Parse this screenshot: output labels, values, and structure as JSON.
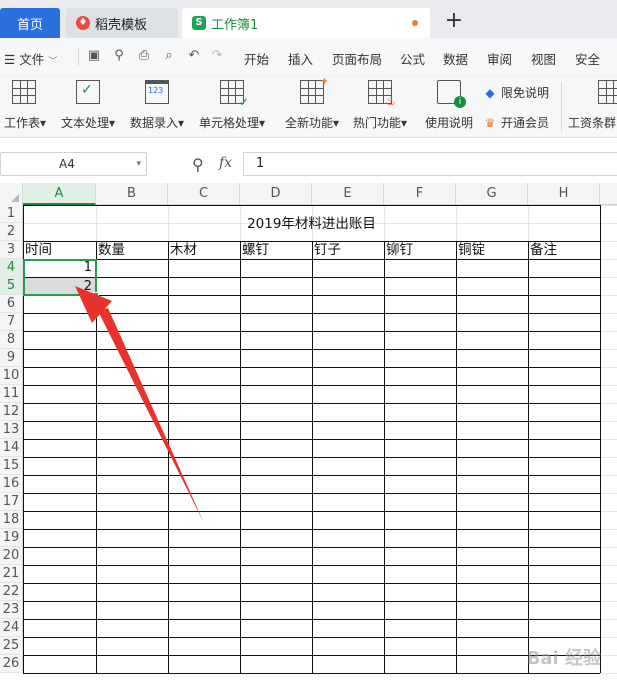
{
  "tabs": {
    "home": "首页",
    "template": "稻壳模板",
    "workbook": "工作簿1",
    "template_icon": "flame-icon",
    "workbook_icon": "sheet-s-icon",
    "new_tab": "+"
  },
  "menu": {
    "file": "文件",
    "items": [
      "开始",
      "插入",
      "页面布局",
      "公式",
      "数据",
      "审阅",
      "视图",
      "安全"
    ]
  },
  "toolbar": {
    "buttons": [
      "工作表",
      "文本处理",
      "数据录入",
      "单元格处理",
      "全新功能",
      "热门功能",
      "使用说明"
    ],
    "side": [
      "限免说明",
      "开通会员"
    ],
    "extra": "工资条群"
  },
  "formula_bar": {
    "name_box": "A4",
    "fx": "fx",
    "value": "1"
  },
  "sheet": {
    "columns": [
      "A",
      "B",
      "C",
      "D",
      "E",
      "F",
      "G",
      "H"
    ],
    "active_column": "A",
    "rows": [
      "1",
      "2",
      "3",
      "4",
      "5",
      "6",
      "7",
      "8",
      "9",
      "10",
      "11",
      "12",
      "13",
      "14",
      "15",
      "16",
      "17",
      "18",
      "19",
      "20",
      "21",
      "22",
      "23",
      "24",
      "25",
      "26"
    ],
    "active_rows": [
      "4",
      "5"
    ],
    "title": "2019年材料进出账目",
    "headers": [
      "时间",
      "数量",
      "木材",
      "螺钉",
      "钉子",
      "铆钉",
      "铜锭",
      "备注"
    ],
    "values": [
      "1",
      "2"
    ]
  },
  "colors": {
    "accent_green": "#2a9a4b",
    "tab_blue": "#2c6fde",
    "arrow_red": "#e8322b"
  },
  "watermark": "Bai 经验"
}
